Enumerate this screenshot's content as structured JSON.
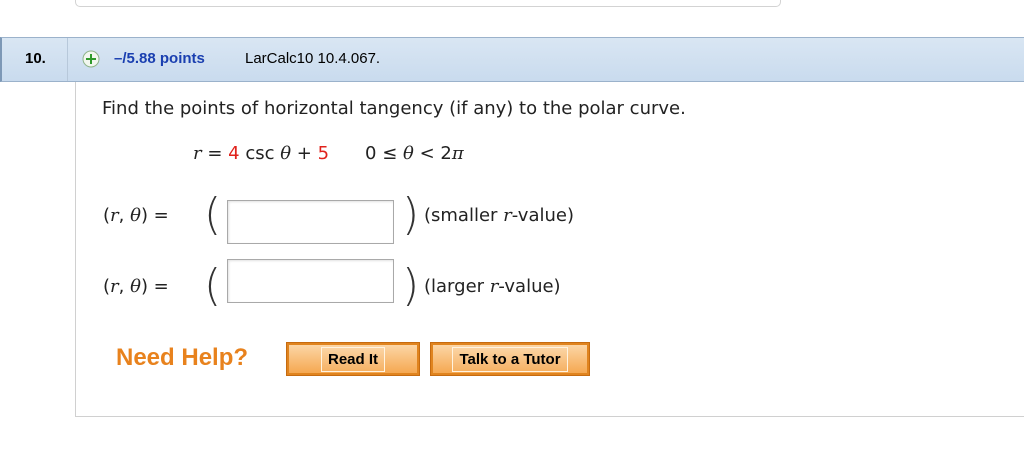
{
  "question": {
    "number": "10.",
    "points": "–/5.88 points",
    "reference": "LarCalc10 10.4.067."
  },
  "prompt": "Find the points of horizontal tangency (if any) to the polar curve.",
  "equation": {
    "lhs": "r",
    "eq": " = ",
    "coef1": "4",
    "func": " csc ",
    "theta": "θ",
    "plus": " + ",
    "coef2": "5",
    "domain_lo": "0 ≤ ",
    "domain_theta": "θ",
    "domain_hi": " < 2",
    "pi": "π"
  },
  "answers": [
    {
      "label_open": "(",
      "r": "r",
      "comma": ", ",
      "theta": "θ",
      "label_close": ")  =",
      "value": "",
      "note_open": "(smaller ",
      "note_r": "r",
      "note_close": "-value)"
    },
    {
      "label_open": "(",
      "r": "r",
      "comma": ", ",
      "theta": "θ",
      "label_close": ")  =",
      "value": "",
      "note_open": "(larger ",
      "note_r": "r",
      "note_close": "-value)"
    }
  ],
  "help": {
    "label": "Need Help?",
    "read_it": "Read It",
    "talk_tutor": "Talk to a Tutor"
  },
  "colors": {
    "header_bg": "#d3e2f1",
    "points_blue": "#1a3fb0",
    "accent_red": "#e0221c",
    "help_orange": "#e8821d",
    "button_orange": "#f5a851"
  }
}
